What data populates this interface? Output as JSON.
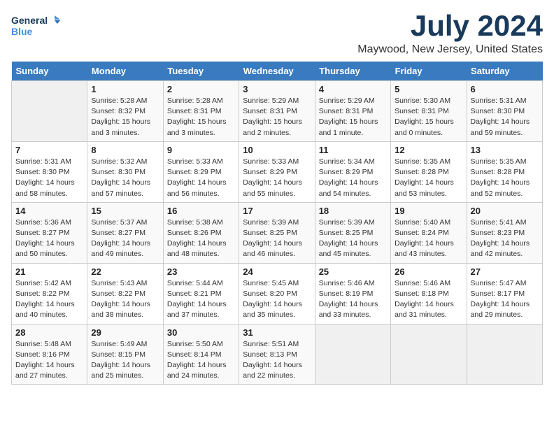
{
  "logo": {
    "line1": "General",
    "line2": "Blue"
  },
  "title": "July 2024",
  "location": "Maywood, New Jersey, United States",
  "weekdays": [
    "Sunday",
    "Monday",
    "Tuesday",
    "Wednesday",
    "Thursday",
    "Friday",
    "Saturday"
  ],
  "weeks": [
    [
      {
        "day": "",
        "info": ""
      },
      {
        "day": "1",
        "info": "Sunrise: 5:28 AM\nSunset: 8:32 PM\nDaylight: 15 hours\nand 3 minutes."
      },
      {
        "day": "2",
        "info": "Sunrise: 5:28 AM\nSunset: 8:31 PM\nDaylight: 15 hours\nand 3 minutes."
      },
      {
        "day": "3",
        "info": "Sunrise: 5:29 AM\nSunset: 8:31 PM\nDaylight: 15 hours\nand 2 minutes."
      },
      {
        "day": "4",
        "info": "Sunrise: 5:29 AM\nSunset: 8:31 PM\nDaylight: 15 hours\nand 1 minute."
      },
      {
        "day": "5",
        "info": "Sunrise: 5:30 AM\nSunset: 8:31 PM\nDaylight: 15 hours\nand 0 minutes."
      },
      {
        "day": "6",
        "info": "Sunrise: 5:31 AM\nSunset: 8:30 PM\nDaylight: 14 hours\nand 59 minutes."
      }
    ],
    [
      {
        "day": "7",
        "info": "Sunrise: 5:31 AM\nSunset: 8:30 PM\nDaylight: 14 hours\nand 58 minutes."
      },
      {
        "day": "8",
        "info": "Sunrise: 5:32 AM\nSunset: 8:30 PM\nDaylight: 14 hours\nand 57 minutes."
      },
      {
        "day": "9",
        "info": "Sunrise: 5:33 AM\nSunset: 8:29 PM\nDaylight: 14 hours\nand 56 minutes."
      },
      {
        "day": "10",
        "info": "Sunrise: 5:33 AM\nSunset: 8:29 PM\nDaylight: 14 hours\nand 55 minutes."
      },
      {
        "day": "11",
        "info": "Sunrise: 5:34 AM\nSunset: 8:29 PM\nDaylight: 14 hours\nand 54 minutes."
      },
      {
        "day": "12",
        "info": "Sunrise: 5:35 AM\nSunset: 8:28 PM\nDaylight: 14 hours\nand 53 minutes."
      },
      {
        "day": "13",
        "info": "Sunrise: 5:35 AM\nSunset: 8:28 PM\nDaylight: 14 hours\nand 52 minutes."
      }
    ],
    [
      {
        "day": "14",
        "info": "Sunrise: 5:36 AM\nSunset: 8:27 PM\nDaylight: 14 hours\nand 50 minutes."
      },
      {
        "day": "15",
        "info": "Sunrise: 5:37 AM\nSunset: 8:27 PM\nDaylight: 14 hours\nand 49 minutes."
      },
      {
        "day": "16",
        "info": "Sunrise: 5:38 AM\nSunset: 8:26 PM\nDaylight: 14 hours\nand 48 minutes."
      },
      {
        "day": "17",
        "info": "Sunrise: 5:39 AM\nSunset: 8:25 PM\nDaylight: 14 hours\nand 46 minutes."
      },
      {
        "day": "18",
        "info": "Sunrise: 5:39 AM\nSunset: 8:25 PM\nDaylight: 14 hours\nand 45 minutes."
      },
      {
        "day": "19",
        "info": "Sunrise: 5:40 AM\nSunset: 8:24 PM\nDaylight: 14 hours\nand 43 minutes."
      },
      {
        "day": "20",
        "info": "Sunrise: 5:41 AM\nSunset: 8:23 PM\nDaylight: 14 hours\nand 42 minutes."
      }
    ],
    [
      {
        "day": "21",
        "info": "Sunrise: 5:42 AM\nSunset: 8:22 PM\nDaylight: 14 hours\nand 40 minutes."
      },
      {
        "day": "22",
        "info": "Sunrise: 5:43 AM\nSunset: 8:22 PM\nDaylight: 14 hours\nand 38 minutes."
      },
      {
        "day": "23",
        "info": "Sunrise: 5:44 AM\nSunset: 8:21 PM\nDaylight: 14 hours\nand 37 minutes."
      },
      {
        "day": "24",
        "info": "Sunrise: 5:45 AM\nSunset: 8:20 PM\nDaylight: 14 hours\nand 35 minutes."
      },
      {
        "day": "25",
        "info": "Sunrise: 5:46 AM\nSunset: 8:19 PM\nDaylight: 14 hours\nand 33 minutes."
      },
      {
        "day": "26",
        "info": "Sunrise: 5:46 AM\nSunset: 8:18 PM\nDaylight: 14 hours\nand 31 minutes."
      },
      {
        "day": "27",
        "info": "Sunrise: 5:47 AM\nSunset: 8:17 PM\nDaylight: 14 hours\nand 29 minutes."
      }
    ],
    [
      {
        "day": "28",
        "info": "Sunrise: 5:48 AM\nSunset: 8:16 PM\nDaylight: 14 hours\nand 27 minutes."
      },
      {
        "day": "29",
        "info": "Sunrise: 5:49 AM\nSunset: 8:15 PM\nDaylight: 14 hours\nand 25 minutes."
      },
      {
        "day": "30",
        "info": "Sunrise: 5:50 AM\nSunset: 8:14 PM\nDaylight: 14 hours\nand 24 minutes."
      },
      {
        "day": "31",
        "info": "Sunrise: 5:51 AM\nSunset: 8:13 PM\nDaylight: 14 hours\nand 22 minutes."
      },
      {
        "day": "",
        "info": ""
      },
      {
        "day": "",
        "info": ""
      },
      {
        "day": "",
        "info": ""
      }
    ]
  ]
}
